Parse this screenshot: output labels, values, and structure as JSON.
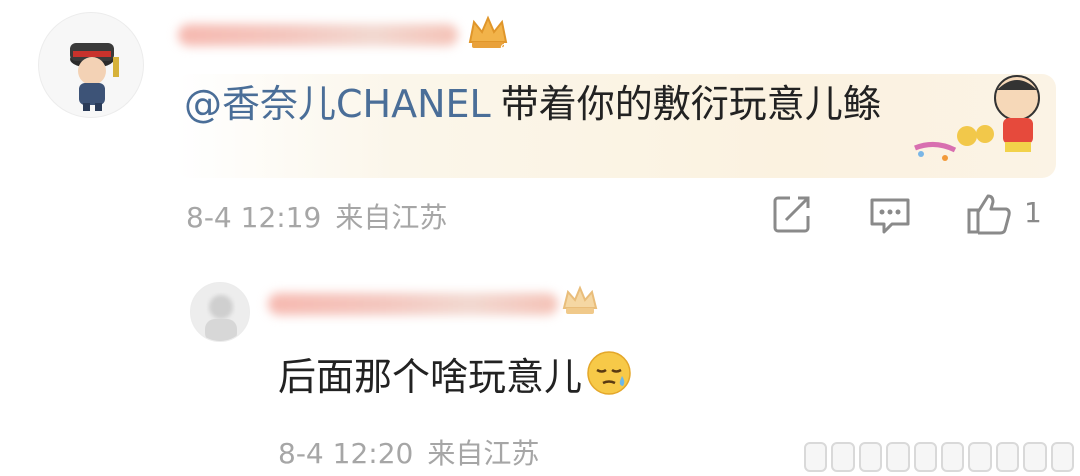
{
  "comments": [
    {
      "mention": "@香奈儿CHANEL",
      "text": "带着你的敷衍玩意儿鲦",
      "date": "8-4 12:19",
      "location": "来自江苏",
      "like_count": "1",
      "icons": {
        "share": "share-icon",
        "reply": "comment-icon",
        "like": "thumbs-up-icon",
        "crown": "crown-badge-icon"
      }
    },
    {
      "text": "后面那个啥玩意儿",
      "emoji": "sweat-sleepy-emoji",
      "date": "8-4 12:20",
      "location": "来自江苏",
      "icons": {
        "crown": "crown-badge-icon"
      }
    }
  ],
  "colors": {
    "mention": "#4a6e98",
    "meta": "#a6a6a6",
    "text": "#222222",
    "bubble": "#fbf3e5"
  }
}
